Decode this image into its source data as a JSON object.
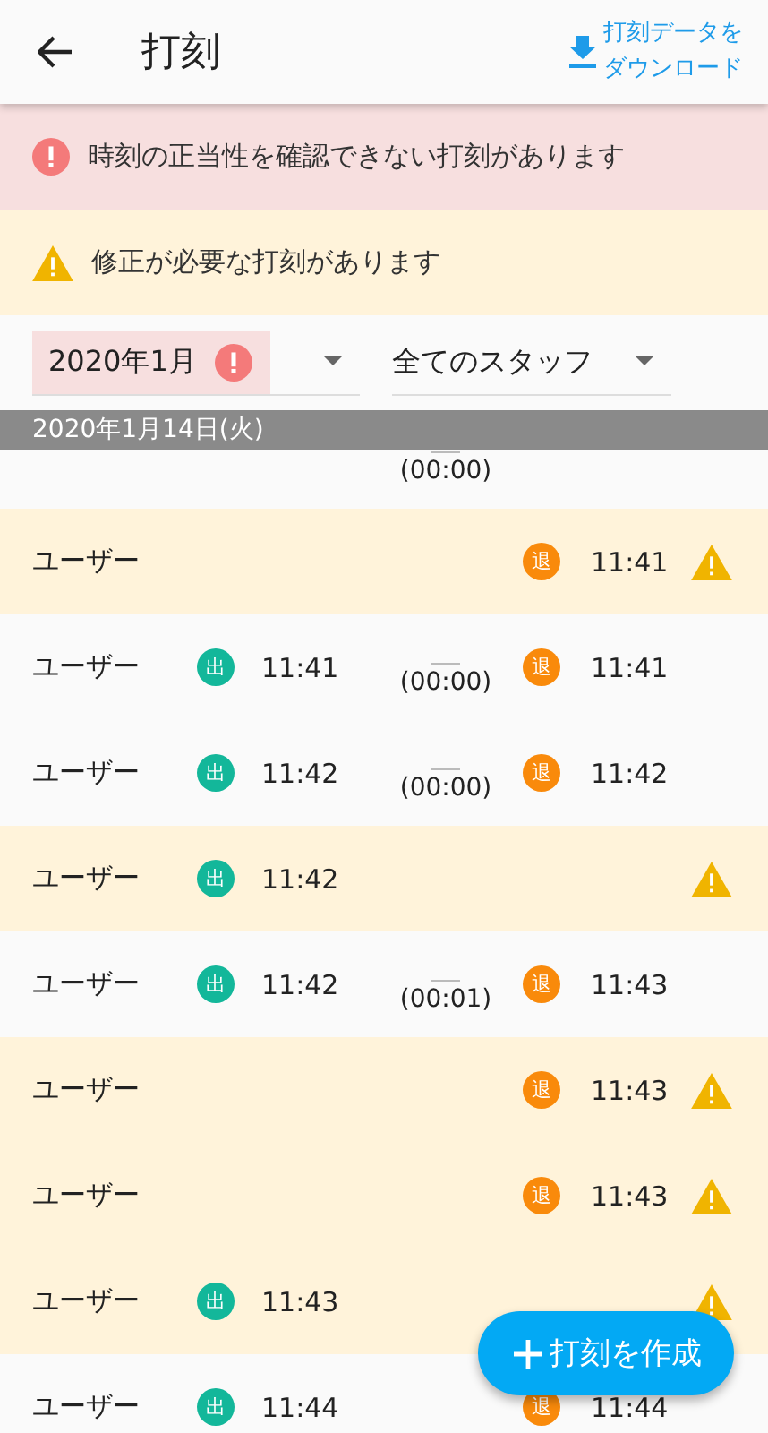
{
  "header": {
    "title": "打刻",
    "download": [
      "打刻データを",
      "ダウンロード"
    ]
  },
  "alerts": [
    {
      "kind": "error",
      "text": "時刻の正当性を確認できない打刻があります"
    },
    {
      "kind": "warning",
      "text": "修正が必要な打刻があります"
    }
  ],
  "filters": {
    "month": {
      "value": "2020年1月",
      "error": true
    },
    "staff": {
      "value": "全てのスタッフ"
    }
  },
  "date_header": "2020年1月14日(火)",
  "rows": [
    {
      "duration": "(00:00)",
      "warning": false
    },
    {
      "name": "ユーザー",
      "out_badge": "退",
      "out_time": "11:41",
      "warning": true
    },
    {
      "name": "ユーザー",
      "in_badge": "出",
      "in_time": "11:41",
      "duration": "(00:00)",
      "out_badge": "退",
      "out_time": "11:41",
      "warning": false
    },
    {
      "name": "ユーザー",
      "in_badge": "出",
      "in_time": "11:42",
      "duration": "(00:00)",
      "out_badge": "退",
      "out_time": "11:42",
      "warning": false
    },
    {
      "name": "ユーザー",
      "in_badge": "出",
      "in_time": "11:42",
      "warning": true
    },
    {
      "name": "ユーザー",
      "in_badge": "出",
      "in_time": "11:42",
      "duration": "(00:01)",
      "out_badge": "退",
      "out_time": "11:43",
      "warning": false
    },
    {
      "name": "ユーザー",
      "out_badge": "退",
      "out_time": "11:43",
      "warning": true
    },
    {
      "name": "ユーザー",
      "out_badge": "退",
      "out_time": "11:43",
      "warning": true
    },
    {
      "name": "ユーザー",
      "in_badge": "出",
      "in_time": "11:43",
      "warning": true
    },
    {
      "name": "ユーザー",
      "in_badge": "出",
      "in_time": "11:44",
      "out_badge": "退",
      "out_time": "11:44",
      "warning": false
    }
  ],
  "fab": {
    "label": "打刻を作成"
  }
}
